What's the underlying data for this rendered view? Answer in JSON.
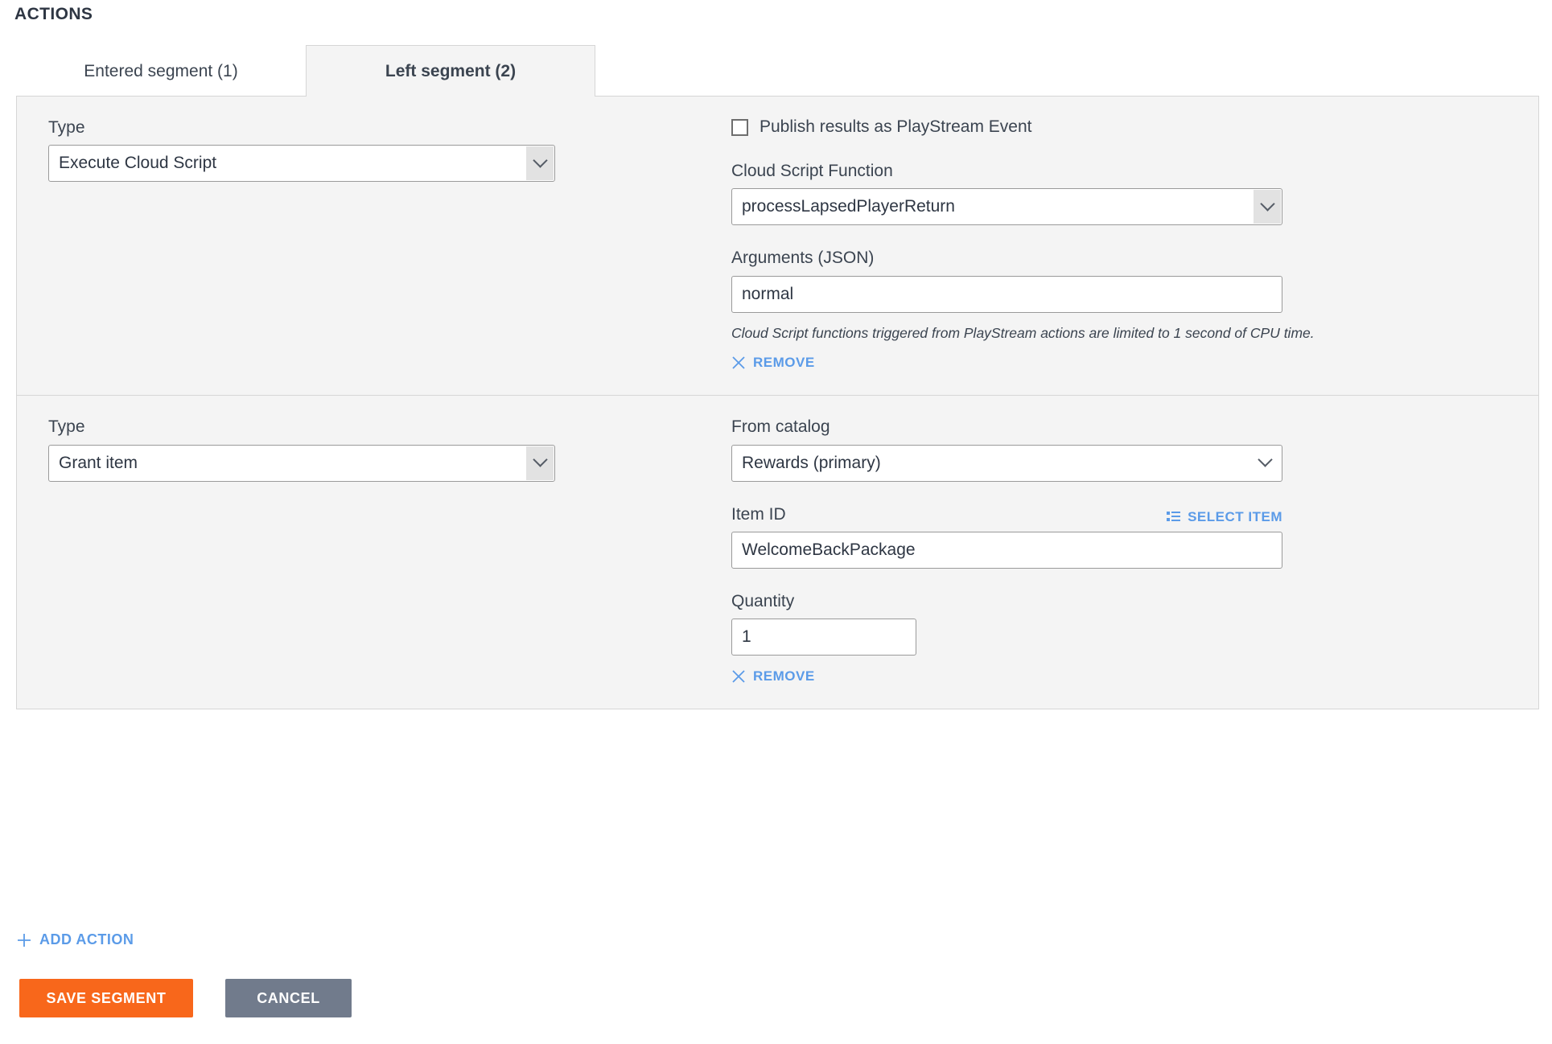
{
  "page": {
    "heading": "ACTIONS"
  },
  "tabs": [
    {
      "label": "Entered segment (1)",
      "active": false,
      "name": "tab-entered-segment"
    },
    {
      "label": "Left segment (2)",
      "active": true,
      "name": "tab-left-segment"
    }
  ],
  "actions": [
    {
      "type_label": "Type",
      "type_value": "Execute Cloud Script",
      "checkbox_label": "Publish results as PlayStream Event",
      "checkbox_checked": false,
      "function_label": "Cloud Script Function",
      "function_value": "processLapsedPlayerReturn",
      "arguments_label": "Arguments (JSON)",
      "arguments_value": "normal",
      "note": "Cloud Script functions triggered from PlayStream actions are limited to 1 second of CPU time.",
      "remove_label": "REMOVE"
    },
    {
      "type_label": "Type",
      "type_value": "Grant item",
      "catalog_label": "From catalog",
      "catalog_value": "Rewards (primary)",
      "item_id_label": "Item ID",
      "select_item_label": "SELECT ITEM",
      "item_id_value": "WelcomeBackPackage",
      "quantity_label": "Quantity",
      "quantity_value": "1",
      "remove_label": "REMOVE"
    }
  ],
  "add_action_label": "ADD ACTION",
  "footer": {
    "save_label": "SAVE SEGMENT",
    "cancel_label": "CANCEL"
  },
  "icons": {
    "plus": "plus-icon",
    "close": "close-icon",
    "list": "list-icon",
    "chevron": "chevron-down-icon"
  },
  "colors": {
    "accent_orange": "#f8671b",
    "cancel_gray": "#717b8c",
    "link_blue": "#5b9be8",
    "panel_bg": "#f4f4f4",
    "border": "#d6d6d6",
    "text": "#3b4450"
  }
}
